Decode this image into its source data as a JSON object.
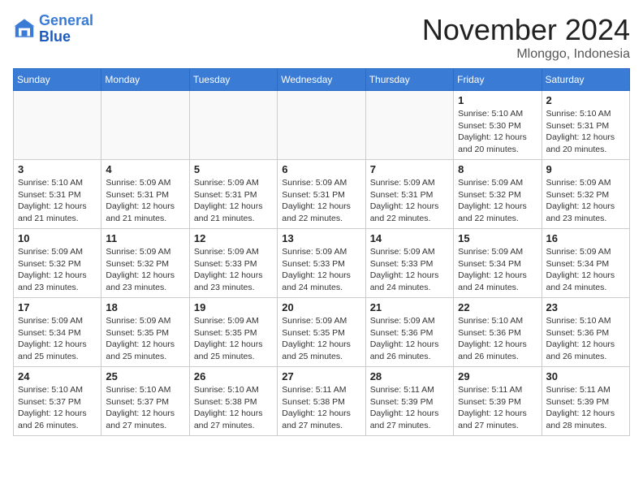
{
  "header": {
    "logo_line1": "General",
    "logo_line2": "Blue",
    "month": "November 2024",
    "location": "Mlonggo, Indonesia"
  },
  "weekdays": [
    "Sunday",
    "Monday",
    "Tuesday",
    "Wednesday",
    "Thursday",
    "Friday",
    "Saturday"
  ],
  "weeks": [
    [
      {
        "day": "",
        "info": ""
      },
      {
        "day": "",
        "info": ""
      },
      {
        "day": "",
        "info": ""
      },
      {
        "day": "",
        "info": ""
      },
      {
        "day": "",
        "info": ""
      },
      {
        "day": "1",
        "info": "Sunrise: 5:10 AM\nSunset: 5:30 PM\nDaylight: 12 hours\nand 20 minutes."
      },
      {
        "day": "2",
        "info": "Sunrise: 5:10 AM\nSunset: 5:31 PM\nDaylight: 12 hours\nand 20 minutes."
      }
    ],
    [
      {
        "day": "3",
        "info": "Sunrise: 5:10 AM\nSunset: 5:31 PM\nDaylight: 12 hours\nand 21 minutes."
      },
      {
        "day": "4",
        "info": "Sunrise: 5:09 AM\nSunset: 5:31 PM\nDaylight: 12 hours\nand 21 minutes."
      },
      {
        "day": "5",
        "info": "Sunrise: 5:09 AM\nSunset: 5:31 PM\nDaylight: 12 hours\nand 21 minutes."
      },
      {
        "day": "6",
        "info": "Sunrise: 5:09 AM\nSunset: 5:31 PM\nDaylight: 12 hours\nand 22 minutes."
      },
      {
        "day": "7",
        "info": "Sunrise: 5:09 AM\nSunset: 5:31 PM\nDaylight: 12 hours\nand 22 minutes."
      },
      {
        "day": "8",
        "info": "Sunrise: 5:09 AM\nSunset: 5:32 PM\nDaylight: 12 hours\nand 22 minutes."
      },
      {
        "day": "9",
        "info": "Sunrise: 5:09 AM\nSunset: 5:32 PM\nDaylight: 12 hours\nand 23 minutes."
      }
    ],
    [
      {
        "day": "10",
        "info": "Sunrise: 5:09 AM\nSunset: 5:32 PM\nDaylight: 12 hours\nand 23 minutes."
      },
      {
        "day": "11",
        "info": "Sunrise: 5:09 AM\nSunset: 5:32 PM\nDaylight: 12 hours\nand 23 minutes."
      },
      {
        "day": "12",
        "info": "Sunrise: 5:09 AM\nSunset: 5:33 PM\nDaylight: 12 hours\nand 23 minutes."
      },
      {
        "day": "13",
        "info": "Sunrise: 5:09 AM\nSunset: 5:33 PM\nDaylight: 12 hours\nand 24 minutes."
      },
      {
        "day": "14",
        "info": "Sunrise: 5:09 AM\nSunset: 5:33 PM\nDaylight: 12 hours\nand 24 minutes."
      },
      {
        "day": "15",
        "info": "Sunrise: 5:09 AM\nSunset: 5:34 PM\nDaylight: 12 hours\nand 24 minutes."
      },
      {
        "day": "16",
        "info": "Sunrise: 5:09 AM\nSunset: 5:34 PM\nDaylight: 12 hours\nand 24 minutes."
      }
    ],
    [
      {
        "day": "17",
        "info": "Sunrise: 5:09 AM\nSunset: 5:34 PM\nDaylight: 12 hours\nand 25 minutes."
      },
      {
        "day": "18",
        "info": "Sunrise: 5:09 AM\nSunset: 5:35 PM\nDaylight: 12 hours\nand 25 minutes."
      },
      {
        "day": "19",
        "info": "Sunrise: 5:09 AM\nSunset: 5:35 PM\nDaylight: 12 hours\nand 25 minutes."
      },
      {
        "day": "20",
        "info": "Sunrise: 5:09 AM\nSunset: 5:35 PM\nDaylight: 12 hours\nand 25 minutes."
      },
      {
        "day": "21",
        "info": "Sunrise: 5:09 AM\nSunset: 5:36 PM\nDaylight: 12 hours\nand 26 minutes."
      },
      {
        "day": "22",
        "info": "Sunrise: 5:10 AM\nSunset: 5:36 PM\nDaylight: 12 hours\nand 26 minutes."
      },
      {
        "day": "23",
        "info": "Sunrise: 5:10 AM\nSunset: 5:36 PM\nDaylight: 12 hours\nand 26 minutes."
      }
    ],
    [
      {
        "day": "24",
        "info": "Sunrise: 5:10 AM\nSunset: 5:37 PM\nDaylight: 12 hours\nand 26 minutes."
      },
      {
        "day": "25",
        "info": "Sunrise: 5:10 AM\nSunset: 5:37 PM\nDaylight: 12 hours\nand 27 minutes."
      },
      {
        "day": "26",
        "info": "Sunrise: 5:10 AM\nSunset: 5:38 PM\nDaylight: 12 hours\nand 27 minutes."
      },
      {
        "day": "27",
        "info": "Sunrise: 5:11 AM\nSunset: 5:38 PM\nDaylight: 12 hours\nand 27 minutes."
      },
      {
        "day": "28",
        "info": "Sunrise: 5:11 AM\nSunset: 5:39 PM\nDaylight: 12 hours\nand 27 minutes."
      },
      {
        "day": "29",
        "info": "Sunrise: 5:11 AM\nSunset: 5:39 PM\nDaylight: 12 hours\nand 27 minutes."
      },
      {
        "day": "30",
        "info": "Sunrise: 5:11 AM\nSunset: 5:39 PM\nDaylight: 12 hours\nand 28 minutes."
      }
    ]
  ]
}
